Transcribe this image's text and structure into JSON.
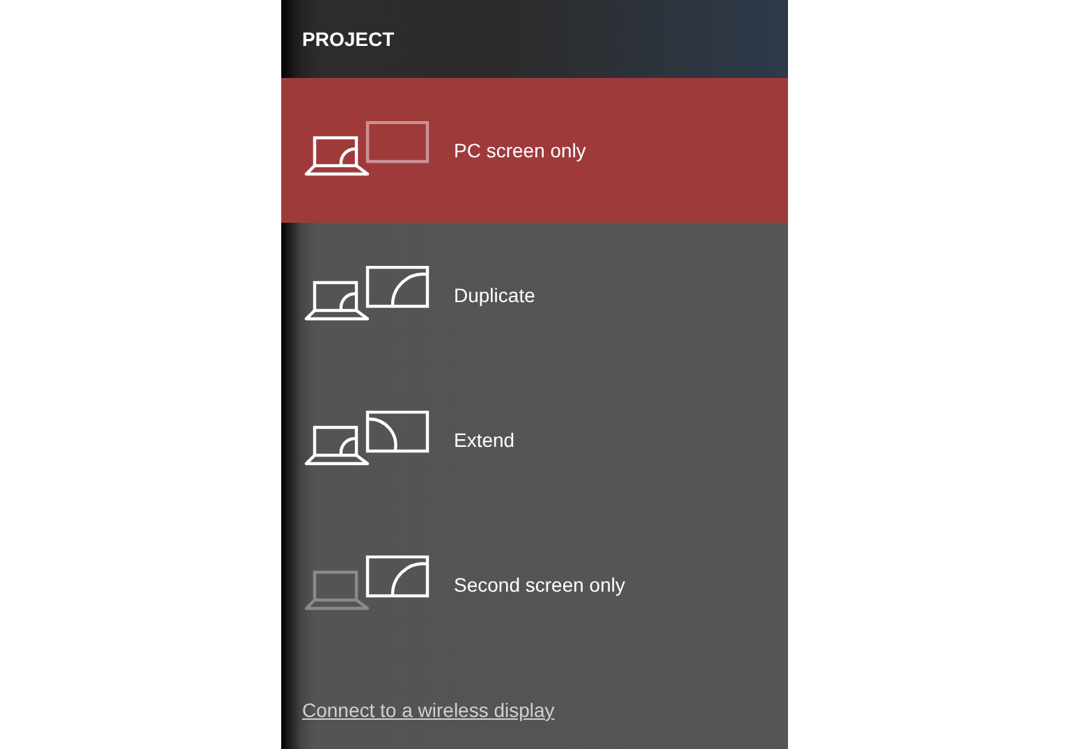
{
  "panel": {
    "title": "PROJECT",
    "options": [
      {
        "kind": "pc_only",
        "label": "PC screen only",
        "selected": true
      },
      {
        "kind": "duplicate",
        "label": "Duplicate",
        "selected": false
      },
      {
        "kind": "extend",
        "label": "Extend",
        "selected": false
      },
      {
        "kind": "second_only",
        "label": "Second screen only",
        "selected": false
      }
    ],
    "link": "Connect to a wireless display"
  }
}
